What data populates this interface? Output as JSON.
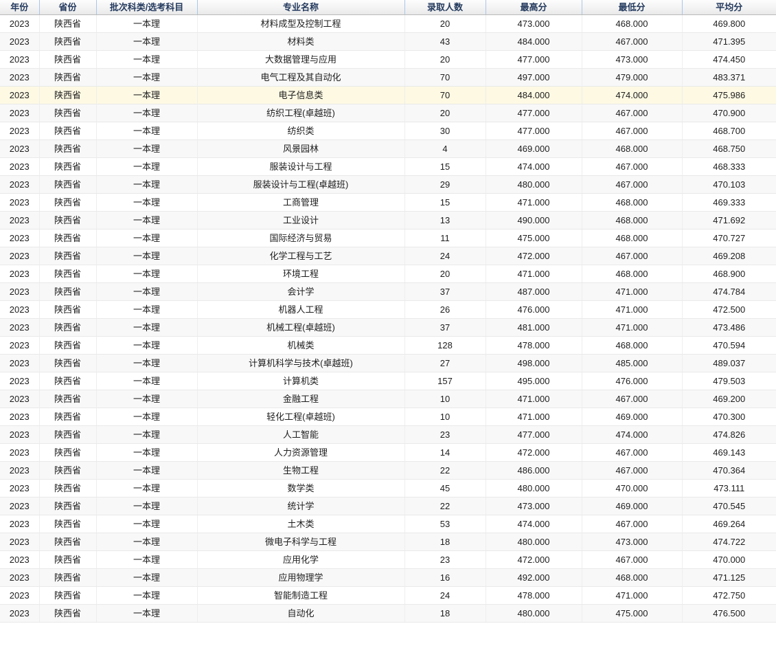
{
  "table": {
    "columns": [
      {
        "key": "year",
        "label": "年份"
      },
      {
        "key": "prov",
        "label": "省份"
      },
      {
        "key": "batch",
        "label": "批次科类/选考科目"
      },
      {
        "key": "major",
        "label": "专业名称"
      },
      {
        "key": "count",
        "label": "录取人数"
      },
      {
        "key": "max",
        "label": "最高分"
      },
      {
        "key": "min",
        "label": "最低分"
      },
      {
        "key": "avg",
        "label": "平均分"
      }
    ],
    "highlighted_row_index": 4,
    "rows": [
      {
        "year": "2023",
        "prov": "陕西省",
        "batch": "一本理",
        "major": "材料成型及控制工程",
        "count": "20",
        "max": "473.000",
        "min": "468.000",
        "avg": "469.800"
      },
      {
        "year": "2023",
        "prov": "陕西省",
        "batch": "一本理",
        "major": "材料类",
        "count": "43",
        "max": "484.000",
        "min": "467.000",
        "avg": "471.395"
      },
      {
        "year": "2023",
        "prov": "陕西省",
        "batch": "一本理",
        "major": "大数据管理与应用",
        "count": "20",
        "max": "477.000",
        "min": "473.000",
        "avg": "474.450"
      },
      {
        "year": "2023",
        "prov": "陕西省",
        "batch": "一本理",
        "major": "电气工程及其自动化",
        "count": "70",
        "max": "497.000",
        "min": "479.000",
        "avg": "483.371"
      },
      {
        "year": "2023",
        "prov": "陕西省",
        "batch": "一本理",
        "major": "电子信息类",
        "count": "70",
        "max": "484.000",
        "min": "474.000",
        "avg": "475.986"
      },
      {
        "year": "2023",
        "prov": "陕西省",
        "batch": "一本理",
        "major": "纺织工程(卓越班)",
        "count": "20",
        "max": "477.000",
        "min": "467.000",
        "avg": "470.900"
      },
      {
        "year": "2023",
        "prov": "陕西省",
        "batch": "一本理",
        "major": "纺织类",
        "count": "30",
        "max": "477.000",
        "min": "467.000",
        "avg": "468.700"
      },
      {
        "year": "2023",
        "prov": "陕西省",
        "batch": "一本理",
        "major": "风景园林",
        "count": "4",
        "max": "469.000",
        "min": "468.000",
        "avg": "468.750"
      },
      {
        "year": "2023",
        "prov": "陕西省",
        "batch": "一本理",
        "major": "服装设计与工程",
        "count": "15",
        "max": "474.000",
        "min": "467.000",
        "avg": "468.333"
      },
      {
        "year": "2023",
        "prov": "陕西省",
        "batch": "一本理",
        "major": "服装设计与工程(卓越班)",
        "count": "29",
        "max": "480.000",
        "min": "467.000",
        "avg": "470.103"
      },
      {
        "year": "2023",
        "prov": "陕西省",
        "batch": "一本理",
        "major": "工商管理",
        "count": "15",
        "max": "471.000",
        "min": "468.000",
        "avg": "469.333"
      },
      {
        "year": "2023",
        "prov": "陕西省",
        "batch": "一本理",
        "major": "工业设计",
        "count": "13",
        "max": "490.000",
        "min": "468.000",
        "avg": "471.692"
      },
      {
        "year": "2023",
        "prov": "陕西省",
        "batch": "一本理",
        "major": "国际经济与贸易",
        "count": "11",
        "max": "475.000",
        "min": "468.000",
        "avg": "470.727"
      },
      {
        "year": "2023",
        "prov": "陕西省",
        "batch": "一本理",
        "major": "化学工程与工艺",
        "count": "24",
        "max": "472.000",
        "min": "467.000",
        "avg": "469.208"
      },
      {
        "year": "2023",
        "prov": "陕西省",
        "batch": "一本理",
        "major": "环境工程",
        "count": "20",
        "max": "471.000",
        "min": "468.000",
        "avg": "468.900"
      },
      {
        "year": "2023",
        "prov": "陕西省",
        "batch": "一本理",
        "major": "会计学",
        "count": "37",
        "max": "487.000",
        "min": "471.000",
        "avg": "474.784"
      },
      {
        "year": "2023",
        "prov": "陕西省",
        "batch": "一本理",
        "major": "机器人工程",
        "count": "26",
        "max": "476.000",
        "min": "471.000",
        "avg": "472.500"
      },
      {
        "year": "2023",
        "prov": "陕西省",
        "batch": "一本理",
        "major": "机械工程(卓越班)",
        "count": "37",
        "max": "481.000",
        "min": "471.000",
        "avg": "473.486"
      },
      {
        "year": "2023",
        "prov": "陕西省",
        "batch": "一本理",
        "major": "机械类",
        "count": "128",
        "max": "478.000",
        "min": "468.000",
        "avg": "470.594"
      },
      {
        "year": "2023",
        "prov": "陕西省",
        "batch": "一本理",
        "major": "计算机科学与技术(卓越班)",
        "count": "27",
        "max": "498.000",
        "min": "485.000",
        "avg": "489.037"
      },
      {
        "year": "2023",
        "prov": "陕西省",
        "batch": "一本理",
        "major": "计算机类",
        "count": "157",
        "max": "495.000",
        "min": "476.000",
        "avg": "479.503"
      },
      {
        "year": "2023",
        "prov": "陕西省",
        "batch": "一本理",
        "major": "金融工程",
        "count": "10",
        "max": "471.000",
        "min": "467.000",
        "avg": "469.200"
      },
      {
        "year": "2023",
        "prov": "陕西省",
        "batch": "一本理",
        "major": "轻化工程(卓越班)",
        "count": "10",
        "max": "471.000",
        "min": "469.000",
        "avg": "470.300"
      },
      {
        "year": "2023",
        "prov": "陕西省",
        "batch": "一本理",
        "major": "人工智能",
        "count": "23",
        "max": "477.000",
        "min": "474.000",
        "avg": "474.826"
      },
      {
        "year": "2023",
        "prov": "陕西省",
        "batch": "一本理",
        "major": "人力资源管理",
        "count": "14",
        "max": "472.000",
        "min": "467.000",
        "avg": "469.143"
      },
      {
        "year": "2023",
        "prov": "陕西省",
        "batch": "一本理",
        "major": "生物工程",
        "count": "22",
        "max": "486.000",
        "min": "467.000",
        "avg": "470.364"
      },
      {
        "year": "2023",
        "prov": "陕西省",
        "batch": "一本理",
        "major": "数学类",
        "count": "45",
        "max": "480.000",
        "min": "470.000",
        "avg": "473.111"
      },
      {
        "year": "2023",
        "prov": "陕西省",
        "batch": "一本理",
        "major": "统计学",
        "count": "22",
        "max": "473.000",
        "min": "469.000",
        "avg": "470.545"
      },
      {
        "year": "2023",
        "prov": "陕西省",
        "batch": "一本理",
        "major": "土木类",
        "count": "53",
        "max": "474.000",
        "min": "467.000",
        "avg": "469.264"
      },
      {
        "year": "2023",
        "prov": "陕西省",
        "batch": "一本理",
        "major": "微电子科学与工程",
        "count": "18",
        "max": "480.000",
        "min": "473.000",
        "avg": "474.722"
      },
      {
        "year": "2023",
        "prov": "陕西省",
        "batch": "一本理",
        "major": "应用化学",
        "count": "23",
        "max": "472.000",
        "min": "467.000",
        "avg": "470.000"
      },
      {
        "year": "2023",
        "prov": "陕西省",
        "batch": "一本理",
        "major": "应用物理学",
        "count": "16",
        "max": "492.000",
        "min": "468.000",
        "avg": "471.125"
      },
      {
        "year": "2023",
        "prov": "陕西省",
        "batch": "一本理",
        "major": "智能制造工程",
        "count": "24",
        "max": "478.000",
        "min": "471.000",
        "avg": "472.750"
      },
      {
        "year": "2023",
        "prov": "陕西省",
        "batch": "一本理",
        "major": "自动化",
        "count": "18",
        "max": "480.000",
        "min": "475.000",
        "avg": "476.500"
      }
    ]
  },
  "colors": {
    "header_text": "#243a5e",
    "header_divider": "#a8c6ea",
    "row_alt_bg": "#f8f8f8",
    "row_highlight_bg": "#fdf9e3",
    "body_text": "#1d1d1d"
  }
}
